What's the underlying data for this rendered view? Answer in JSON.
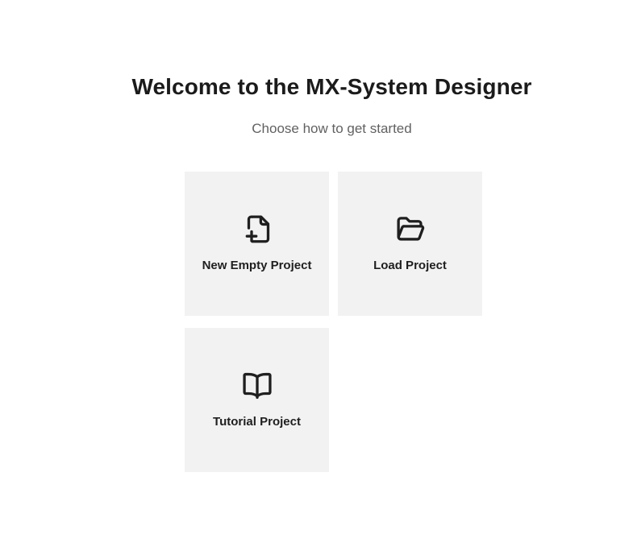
{
  "welcome": {
    "title": "Welcome to the MX-System Designer",
    "subtitle": "Choose how to get started"
  },
  "options": [
    {
      "label": "New Empty Project",
      "icon": "document-add-icon"
    },
    {
      "label": "Load Project",
      "icon": "folder-open-icon"
    },
    {
      "label": "Tutorial Project",
      "icon": "book-open-icon"
    }
  ],
  "colors": {
    "card_background": "#f2f2f2",
    "title_text": "#1b1b1b",
    "subtitle_text": "#616161",
    "icon_stroke": "#1f1f1f"
  }
}
